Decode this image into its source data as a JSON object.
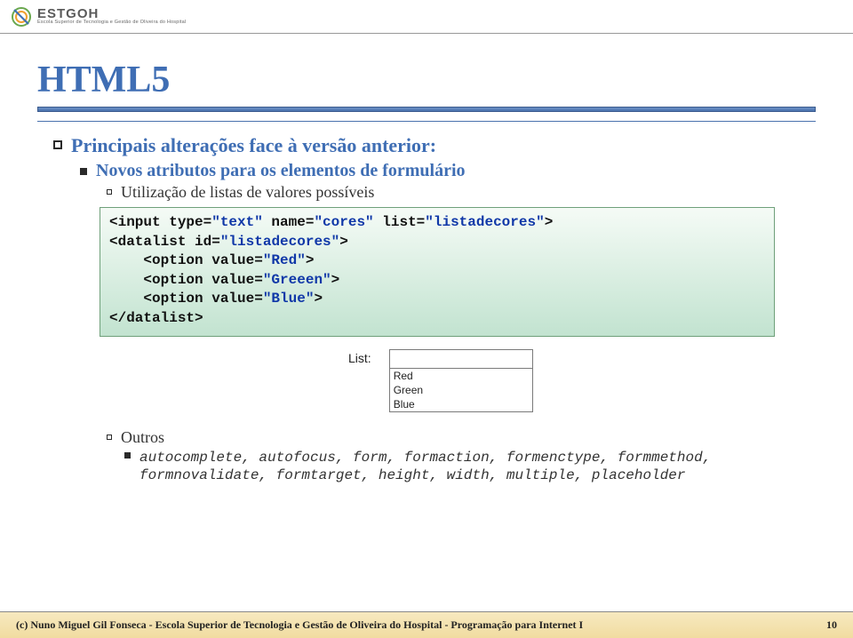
{
  "logo": {
    "name": "ESTGOH",
    "subtitle": "Escola Superior de Tecnologia e Gestão de Oliveira do Hospital"
  },
  "slide": {
    "title": "HTML5",
    "bullet1": "Principais alterações face à versão anterior:",
    "bullet2": "Novos atributos para os elementos de formulário",
    "bullet3": "Utilização de listas de valores possíveis",
    "code": {
      "l1a": "<input type=",
      "l1b": "\"text\"",
      "l1c": " name=",
      "l1d": "\"cores\"",
      "l1e": " list=",
      "l1f": "\"listadecores\"",
      "l1g": ">",
      "l2a": "<datalist id=",
      "l2b": "\"listadecores\"",
      "l2c": ">",
      "l3a": "    <option value=",
      "l3b": "\"Red\"",
      "l3c": ">",
      "l4a": "    <option value=",
      "l4b": "\"Greeen\"",
      "l4c": ">",
      "l5a": "    <option value=",
      "l5b": "\"Blue\"",
      "l5c": ">",
      "l6": "</datalist>"
    },
    "demo": {
      "label": "List:",
      "opt1": "Red",
      "opt2": "Green",
      "opt3": "Blue"
    },
    "outros_label": "Outros",
    "outros_detail": "autocomplete, autofocus, form, formaction, formenctype, formmethod, formnovalidate, formtarget, height, width, multiple, placeholder"
  },
  "footer": {
    "left": "(c) Nuno Miguel Gil Fonseca  -  Escola Superior de Tecnologia e Gestão de Oliveira do Hospital  -  Programação para Internet I",
    "page": "10"
  }
}
